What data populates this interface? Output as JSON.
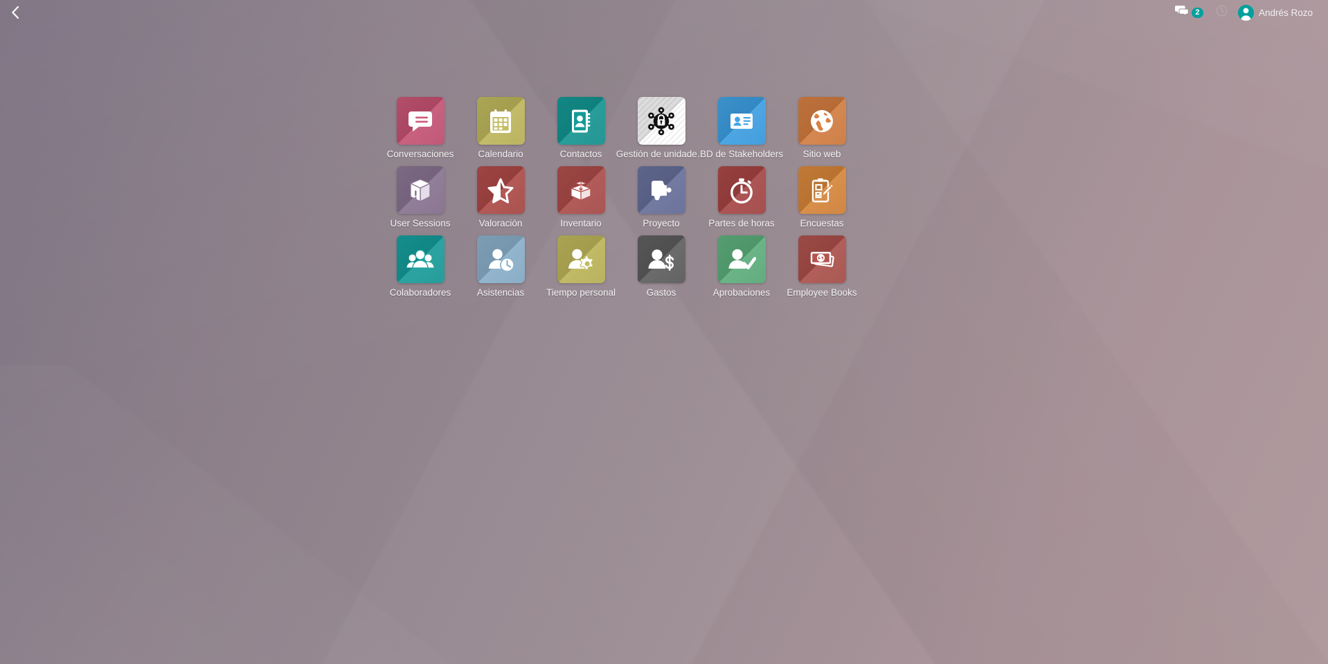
{
  "topbar": {
    "back_icon": "chevron-left-icon",
    "messages": {
      "icon": "messages-icon",
      "count": "2"
    },
    "activity": {
      "icon": "clock-icon"
    },
    "user": {
      "avatar_icon": "user-avatar-icon",
      "name": "Andrés Rozo"
    }
  },
  "apps": [
    {
      "label": "Conversaciones",
      "icon": "speech-bubble-icon",
      "color": "#cd5a78",
      "color2": "#b9466a"
    },
    {
      "label": "Calendario",
      "icon": "calendar-icon",
      "color": "#c4bd63",
      "color2": "#b3ac50"
    },
    {
      "label": "Contactos",
      "icon": "address-book-icon",
      "color": "#159b98",
      "color2": "#0d8a87"
    },
    {
      "label": "Gestión de unidade…",
      "icon": "network-lock-icon",
      "color": "#fbfbfb",
      "color2": "#efefef"
    },
    {
      "label": "BD de Stakeholders",
      "icon": "id-card-icon",
      "color": "#45a6e8",
      "color2": "#2f93d8"
    },
    {
      "label": "Sitio web",
      "icon": "globe-icon",
      "color": "#d98246",
      "color2": "#c97235"
    },
    {
      "label": "User Sessions",
      "icon": "box-alert-icon",
      "color": "#8e7896",
      "color2": "#7d6785"
    },
    {
      "label": "Valoración",
      "icon": "half-star-icon",
      "color": "#b34f4c",
      "color2": "#a13f3c"
    },
    {
      "label": "Inventario",
      "icon": "open-box-icon",
      "color": "#b2514e",
      "color2": "#a04240"
    },
    {
      "label": "Proyecto",
      "icon": "puzzle-piece-icon",
      "color": "#6b749f",
      "color2": "#5b648f"
    },
    {
      "label": "Partes de horas",
      "icon": "stopwatch-icon",
      "color": "#ad4a4a",
      "color2": "#9b3b3b"
    },
    {
      "label": "Encuestas",
      "icon": "clipboard-pencil-icon",
      "color": "#dd8b3f",
      "color2": "#cb7a2e"
    },
    {
      "label": "Colaboradores",
      "icon": "people-group-icon",
      "color": "#18a2a0",
      "color2": "#0f918f"
    },
    {
      "label": "Asistencias",
      "icon": "person-clock-icon",
      "color": "#8fb4ce",
      "color2": "#7ea4c0"
    },
    {
      "label": "Tiempo personal",
      "icon": "person-gear-icon",
      "color": "#c2bb5f",
      "color2": "#b1aa4e"
    },
    {
      "label": "Gastos",
      "icon": "person-dollar-icon",
      "color": "#636363",
      "color2": "#525252"
    },
    {
      "label": "Aprobaciones",
      "icon": "person-check-icon",
      "color": "#62b482",
      "color2": "#51a371"
    },
    {
      "label": "Employee Books",
      "icon": "money-bills-icon",
      "color": "#b25550",
      "color2": "#a0453f"
    }
  ]
}
